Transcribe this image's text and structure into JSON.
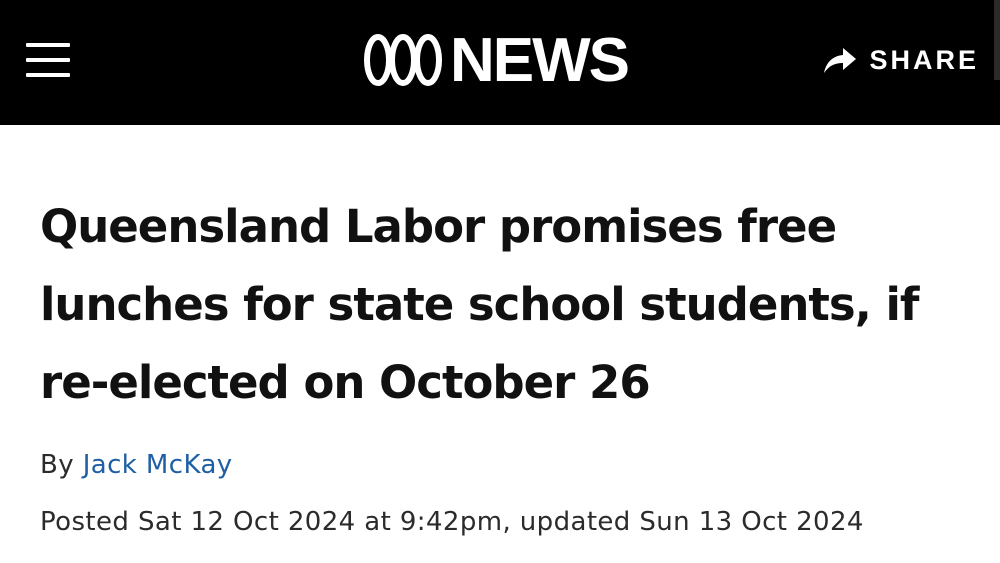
{
  "header": {
    "brand": "NEWS",
    "share_label": "SHARE",
    "menu_icon": "hamburger-menu-icon",
    "share_icon": "share-arrow-icon",
    "logo_icon": "abc-logo-icon",
    "background_color": "#000000",
    "text_color": "#ffffff"
  },
  "article": {
    "headline": "Queensland Labor promises free lunches for state school students, if re-elected on October 26",
    "byline_prefix": "By",
    "author": "Jack McKay",
    "author_color": "#1f5fa5",
    "dateline": "Posted Sat 12 Oct 2024 at 9:42pm, updated Sun 13 Oct 2024"
  }
}
